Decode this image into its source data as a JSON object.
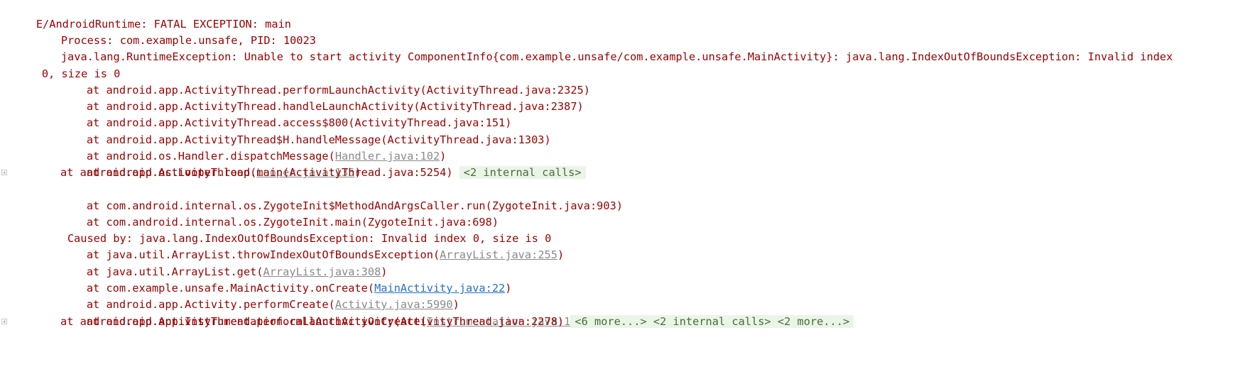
{
  "console": {
    "line_01": "E/AndroidRuntime: FATAL EXCEPTION: main",
    "line_02": "Process: com.example.unsafe, PID: 10023",
    "line_03": "java.lang.RuntimeException: Unable to start activity ComponentInfo{com.example.unsafe/com.example.unsafe.MainActivity}: java.lang.IndexOutOfBoundsException: Invalid index",
    "line_04": "0, size is 0",
    "line_05": "at android.app.ActivityThread.performLaunchActivity(ActivityThread.java:2325)",
    "line_06": "at android.app.ActivityThread.handleLaunchActivity(ActivityThread.java:2387)",
    "line_07": "at android.app.ActivityThread.access$800(ActivityThread.java:151)",
    "line_08": "at android.app.ActivityThread$H.handleMessage(ActivityThread.java:1303)",
    "line_09_prefix": "at android.os.Handler.dispatchMessage(",
    "line_09_link": "Handler.java:102",
    "line_09_suffix": ")",
    "line_10_prefix": "at android.os.Looper.loop(",
    "line_10_link": "Looper.java:135",
    "line_10_suffix": ")",
    "line_11_text": "at android.app.ActivityThread.main(ActivityThread.java:5254)",
    "line_11_fold": "<2 internal calls>",
    "line_12": "at com.android.internal.os.ZygoteInit$MethodAndArgsCaller.run(ZygoteInit.java:903)",
    "line_13": "at com.android.internal.os.ZygoteInit.main(ZygoteInit.java:698)",
    "line_14": "Caused by: java.lang.IndexOutOfBoundsException: Invalid index 0, size is 0",
    "line_15_prefix": "at java.util.ArrayList.throwIndexOutOfBoundsException(",
    "line_15_link": "ArrayList.java:255",
    "line_15_suffix": ")",
    "line_16_prefix": "at java.util.ArrayList.get(",
    "line_16_link": "ArrayList.java:308",
    "line_16_suffix": ")",
    "line_17_prefix": "at com.example.unsafe.MainActivity.onCreate(",
    "line_17_link": "MainActivity.java:22",
    "line_17_suffix": ")",
    "line_18_prefix": "at android.app.Activity.performCreate(",
    "line_18_link": "Activity.java:5990",
    "line_18_suffix": ")",
    "line_19_prefix": "at android.app.Instrumentation.callActivityOnCreate(",
    "line_19_link": "Instrumentation.java:1106",
    "line_19_suffix": ")",
    "line_20_text": "at android.app.ActivityThread.performLaunchActivity(ActivityThread.java:2278)",
    "line_20_fold": "<6 more...> <2 internal calls> <2 more...>"
  },
  "icons": {
    "fold_gutter": "expand-fold-icon"
  },
  "colors": {
    "error_text": "#990000",
    "link_gray": "#8a8a8a",
    "link_blue": "#2470c8",
    "fold_background": "#e9f5e6",
    "fold_text": "#4b6b3c"
  }
}
